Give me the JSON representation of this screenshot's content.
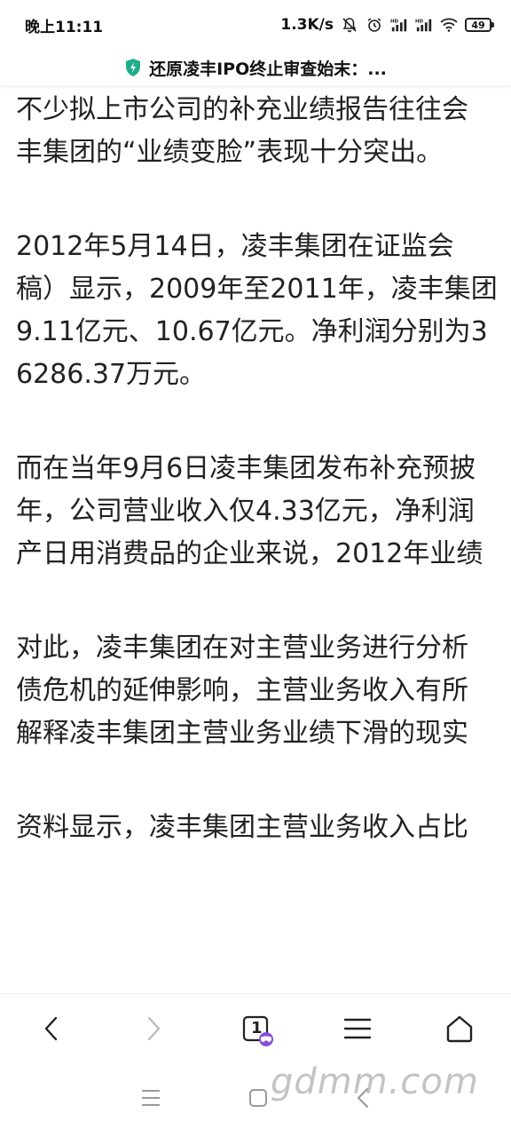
{
  "status_bar": {
    "time": "晚上11:11",
    "net_speed": "1.3K/s",
    "battery": "49"
  },
  "title_bar": {
    "title": "还原凌丰IPO终止审查始末：..."
  },
  "article": {
    "paragraphs": [
      [
        "不少拟上市公司的补充业绩报告往往会",
        "丰集团的“业绩变脸”表现十分突出。"
      ],
      [
        "2012年5月14日，凌丰集团在证监会",
        "稿）显示，2009年至2011年，凌丰集团",
        "9.11亿元、10.67亿元。净利润分别为3",
        "6286.37万元。"
      ],
      [
        "而在当年9月6日凌丰集团发布补充预披",
        "年，公司营业收入仅4.33亿元，净利润",
        "产日用消费品的企业来说，2012年业绩"
      ],
      [
        "对此，凌丰集团在对主营业务进行分析",
        "债危机的延伸影响，主营业务收入有所",
        "解释凌丰集团主营业务业绩下滑的现实"
      ],
      [
        "资料显示，凌丰集团主营业务收入占比"
      ]
    ]
  },
  "nav_bar": {
    "tab_count": "1"
  },
  "watermark": "gdmm.com"
}
